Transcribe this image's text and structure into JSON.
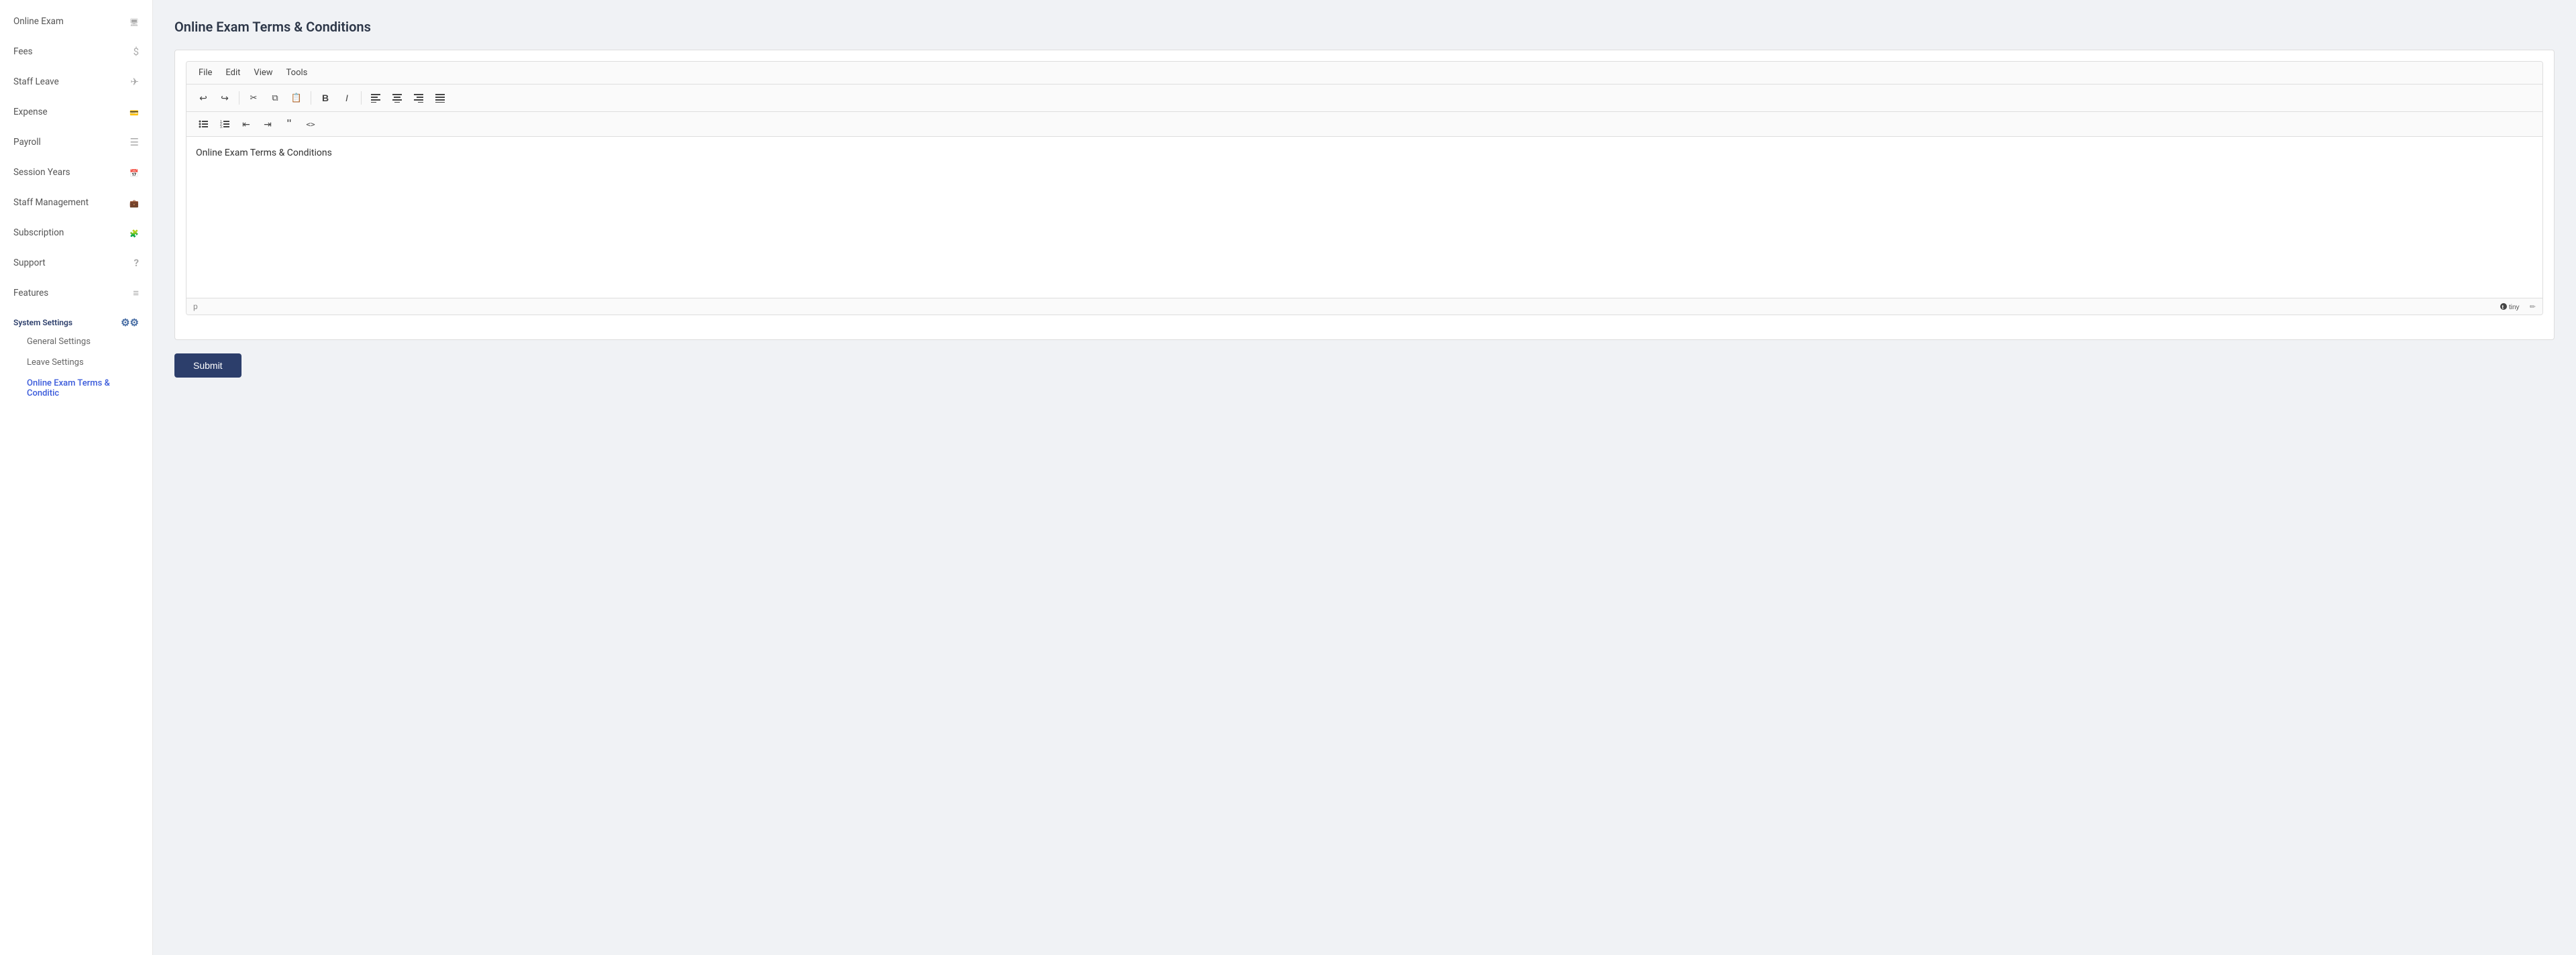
{
  "sidebar": {
    "items": [
      {
        "id": "online-exam",
        "label": "Online Exam",
        "icon": "monitor-icon"
      },
      {
        "id": "fees",
        "label": "Fees",
        "icon": "dollar-icon"
      },
      {
        "id": "staff-leave",
        "label": "Staff Leave",
        "icon": "plane-icon"
      },
      {
        "id": "expense",
        "label": "Expense",
        "icon": "wallet-icon"
      },
      {
        "id": "payroll",
        "label": "Payroll",
        "icon": "bars-icon"
      },
      {
        "id": "session-years",
        "label": "Session Years",
        "icon": "calendar-icon"
      },
      {
        "id": "staff-management",
        "label": "Staff Management",
        "icon": "briefcase-icon"
      },
      {
        "id": "subscription",
        "label": "Subscription",
        "icon": "puzzle-icon"
      },
      {
        "id": "support",
        "label": "Support",
        "icon": "question-icon"
      },
      {
        "id": "features",
        "label": "Features",
        "icon": "list-icon"
      }
    ],
    "system_settings": {
      "label": "System Settings",
      "icon": "gear-icon",
      "sub_items": [
        {
          "id": "general-settings",
          "label": "General Settings",
          "active": false
        },
        {
          "id": "leave-settings",
          "label": "Leave Settings",
          "active": false
        },
        {
          "id": "online-exam-terms",
          "label": "Online Exam Terms & Conditic",
          "active": true
        }
      ]
    }
  },
  "page": {
    "title": "Online Exam Terms & Conditions"
  },
  "editor": {
    "menu": {
      "items": [
        "File",
        "Edit",
        "View",
        "Tools"
      ]
    },
    "toolbar": {
      "buttons": [
        "undo",
        "redo",
        "cut",
        "copy",
        "paste",
        "bold",
        "italic",
        "align-left",
        "align-center",
        "align-right",
        "align-justify"
      ]
    },
    "toolbar2": {
      "buttons": [
        "ul",
        "ol",
        "outdent",
        "indent",
        "blockquote",
        "code"
      ]
    },
    "content": "Online Exam Terms & Conditions",
    "footer": {
      "path": "p",
      "branding": "tiny"
    }
  },
  "submit_button": {
    "label": "Submit"
  }
}
